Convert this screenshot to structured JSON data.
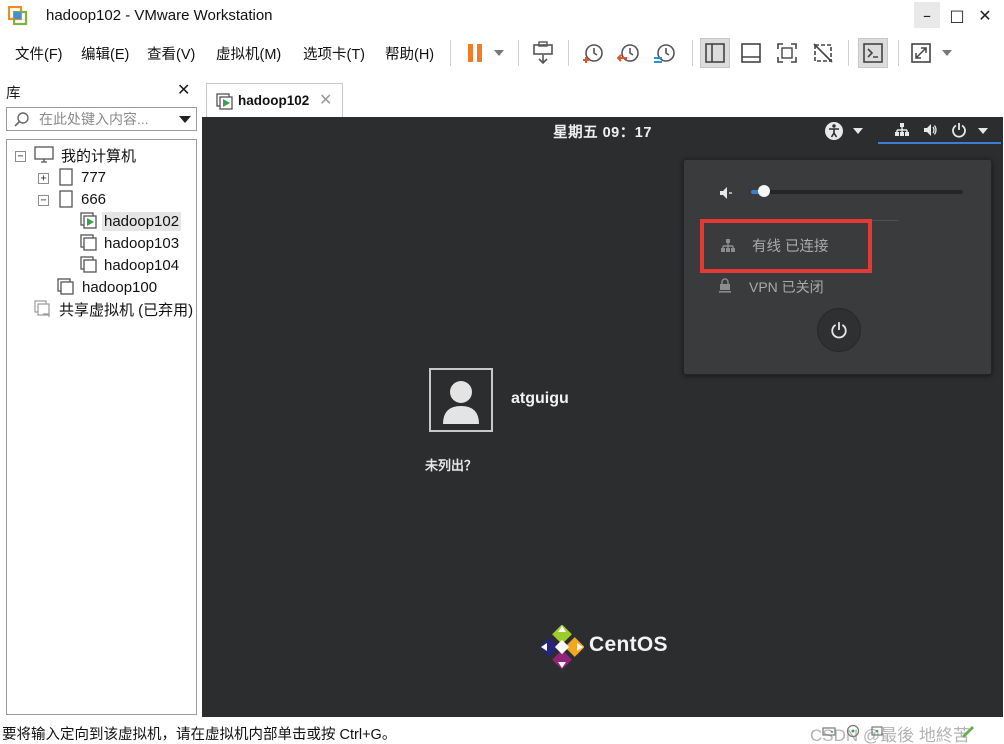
{
  "window": {
    "title": "hadoop102 - VMware Workstation",
    "controls": {
      "minimize": "–",
      "maximize": "□",
      "close": "✕"
    }
  },
  "menu": {
    "items": [
      "文件(F)",
      "编辑(E)",
      "查看(V)",
      "虚拟机(M)",
      "选项卡(T)",
      "帮助(H)"
    ]
  },
  "toolbar": {
    "icons": [
      "pause-icon",
      "send-ctrl-alt-del-icon",
      "snapshot-take-icon",
      "snapshot-revert-icon",
      "snapshot-manager-icon",
      "library-view-icon",
      "thumbnail-view-icon",
      "fullscreen-icon",
      "unity-icon",
      "console-view-icon",
      "stretch-guest-icon"
    ],
    "accent_color": "#f07c28"
  },
  "library": {
    "title": "库",
    "close": "✕",
    "search_placeholder": "在此处键入内容...",
    "tree": {
      "root": "我的计算机",
      "group_777": "777",
      "group_666": "666",
      "vm_hadoop102": "hadoop102",
      "vm_hadoop103": "hadoop103",
      "vm_hadoop104": "hadoop104",
      "vm_hadoop100": "hadoop100",
      "shared": "共享虚拟机 (已弃用)"
    },
    "toggles": {
      "root": "−",
      "group_777": "+",
      "group_666": "−"
    }
  },
  "tab": {
    "label": "hadoop102",
    "close": "✕"
  },
  "vm": {
    "clock": "星期五 09：17",
    "status_menu": {
      "volume_level": 0.06,
      "wired_label": "有线 已连接",
      "vpn_label": "VPN 已关闭"
    },
    "login": {
      "username": "atguigu",
      "not_listed": "未列出？"
    },
    "brand": "CentOS",
    "colors": {
      "background": "#2b2d2e",
      "menu_bg": "#393b3c",
      "highlight_box": "#e53935",
      "accent": "#3d7cd4"
    }
  },
  "statusbar": {
    "message": "要将输入定向到该虚拟机，请在虚拟机内部单击或按 Ctrl+G。",
    "watermark": "CSDN @最後 地終苦"
  }
}
